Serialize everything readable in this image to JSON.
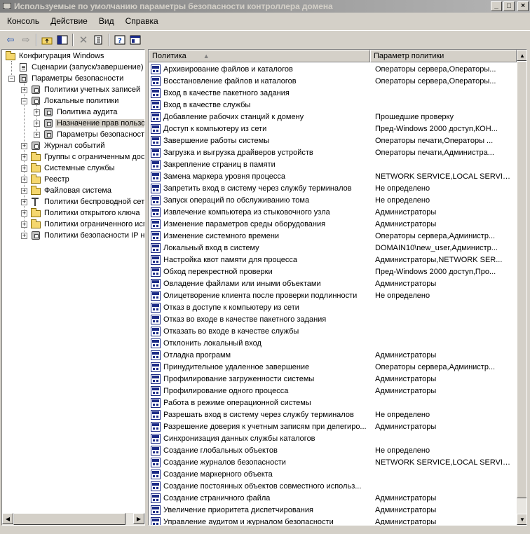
{
  "window": {
    "title": "Используемые по умолчанию параметры безопасности контроллера домена",
    "minimize_glyph": "_",
    "maximize_glyph": "□",
    "close_glyph": "×"
  },
  "menu": [
    "Консоль",
    "Действие",
    "Вид",
    "Справка"
  ],
  "toolbar": {
    "icons": [
      "back-icon",
      "forward-icon",
      "up-folder-icon",
      "show-tree-icon",
      "delete-icon",
      "export-icon",
      "help-icon",
      "console-tree-icon"
    ]
  },
  "tree": {
    "items": [
      "Конфигурация Windows",
      "Сценарии (запуск/завершение)",
      "Параметры безопасности",
      "Политики учетных записей",
      "Локальные политики",
      "Политика аудита",
      "Назначение прав пользователя",
      "Параметры безопасности",
      "Журнал событий",
      "Группы с ограниченным доступом",
      "Системные службы",
      "Реестр",
      "Файловая система",
      "Политики беспроводной сети",
      "Политики открытого ключа",
      "Политики ограниченного использования программ",
      "Политики безопасности IP на"
    ]
  },
  "list": {
    "columns": [
      "Политика",
      "Параметр политики"
    ],
    "rows": [
      {
        "name": "Архивирование файлов и каталогов",
        "value": "Операторы сервера,Операторы..."
      },
      {
        "name": "Восстановление файлов и каталогов",
        "value": "Операторы сервера,Операторы..."
      },
      {
        "name": "Вход в качестве пакетного задания",
        "value": ""
      },
      {
        "name": "Вход в качестве службы",
        "value": ""
      },
      {
        "name": "Добавление рабочих станций к домену",
        "value": "Прошедшие проверку"
      },
      {
        "name": "Доступ к компьютеру из сети",
        "value": "Пред-Windows 2000 доступ,КОН..."
      },
      {
        "name": "Завершение работы системы",
        "value": "Операторы печати,Операторы ..."
      },
      {
        "name": "Загрузка и выгрузка драйверов устройств",
        "value": "Операторы печати,Администра..."
      },
      {
        "name": "Закрепление страниц в памяти",
        "value": ""
      },
      {
        "name": "Замена маркера уровня процесса",
        "value": "NETWORK SERVICE,LOCAL SERVICE"
      },
      {
        "name": "Запретить вход в систему через службу терминалов",
        "value": "Не определено"
      },
      {
        "name": "Запуск операций по обслуживанию тома",
        "value": "Не определено"
      },
      {
        "name": "Извлечение компьютера из стыковочного узла",
        "value": "Администраторы"
      },
      {
        "name": "Изменение параметров среды оборудования",
        "value": "Администраторы"
      },
      {
        "name": "Изменение системного времени",
        "value": "Операторы сервера,Администр..."
      },
      {
        "name": "Локальный вход в систему",
        "value": "DOMAIN10\\new_user,Администр..."
      },
      {
        "name": "Настройка квот памяти для процесса",
        "value": "Администраторы,NETWORK SER..."
      },
      {
        "name": "Обход перекрестной проверки",
        "value": "Пред-Windows 2000 доступ,Про..."
      },
      {
        "name": "Овладение файлами или иными объектами",
        "value": "Администраторы"
      },
      {
        "name": "Олицетворение клиента после проверки подлинности",
        "value": "Не определено"
      },
      {
        "name": "Отказ в доступе к компьютеру из сети",
        "value": ""
      },
      {
        "name": "Отказ во входе в качестве пакетного задания",
        "value": ""
      },
      {
        "name": "Отказать во входе в качестве службы",
        "value": ""
      },
      {
        "name": "Отклонить локальный вход",
        "value": ""
      },
      {
        "name": "Отладка программ",
        "value": "Администраторы"
      },
      {
        "name": "Принудительное удаленное завершение",
        "value": "Операторы сервера,Администр..."
      },
      {
        "name": "Профилирование загруженности системы",
        "value": "Администраторы"
      },
      {
        "name": "Профилирование одного процесса",
        "value": "Администраторы"
      },
      {
        "name": "Работа в режиме операционной системы",
        "value": ""
      },
      {
        "name": "Разрешать вход в систему через службу терминалов",
        "value": "Не определено"
      },
      {
        "name": "Разрешение доверия к учетным записям при делегиро...",
        "value": "Администраторы"
      },
      {
        "name": "Синхронизация данных службы каталогов",
        "value": ""
      },
      {
        "name": "Создание глобальных объектов",
        "value": "Не определено"
      },
      {
        "name": "Создание журналов безопасности",
        "value": "NETWORK SERVICE,LOCAL SERVICE"
      },
      {
        "name": "Создание маркерного объекта",
        "value": ""
      },
      {
        "name": "Создание постоянных объектов совместного использ...",
        "value": ""
      },
      {
        "name": "Создание страничного файла",
        "value": "Администраторы"
      },
      {
        "name": "Увеличение приоритета диспетчирования",
        "value": "Администраторы"
      },
      {
        "name": "Управление аудитом и журналом безопасности",
        "value": "Администраторы"
      }
    ]
  },
  "colors": {
    "titlebar_inactive": "#808080",
    "face": "#d4d0c8",
    "policy_icon": "#1c2b86",
    "folder": "#f5d76e"
  }
}
